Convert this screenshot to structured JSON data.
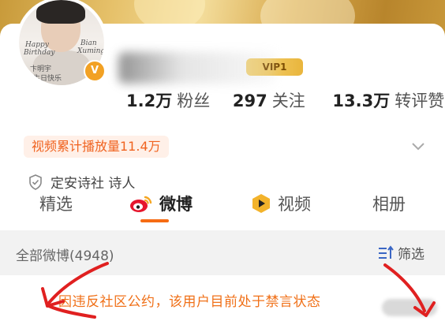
{
  "profile": {
    "avatar_text_1": "Happy",
    "avatar_text_2": "Birthday",
    "avatar_text_3": "Bian",
    "avatar_text_4": "Xuming",
    "avatar_text_5": "卞明宇",
    "avatar_text_6": "生日快乐",
    "vip_label": "VIP1"
  },
  "stats": {
    "followers_value": "1.2万",
    "followers_label": "粉丝",
    "following_value": "297",
    "following_label": "关注",
    "reposts_value": "13.3万",
    "reposts_label": "转评赞"
  },
  "play_count": "视频累计播放量11.4万",
  "verification": "定安诗社 诗人",
  "tabs": [
    {
      "label": "精选"
    },
    {
      "label": "微博"
    },
    {
      "label": "视频"
    },
    {
      "label": "相册"
    }
  ],
  "feed": {
    "title": "全部微博(4948)",
    "filter_label": "筛选"
  },
  "ban_message": "因违反社区公约，该用户目前处于禁言状态",
  "colors": {
    "accent": "#f66c14",
    "ban_text": "#f07018",
    "play_bg": "#fff0e8",
    "annotation_red": "#e02020"
  }
}
